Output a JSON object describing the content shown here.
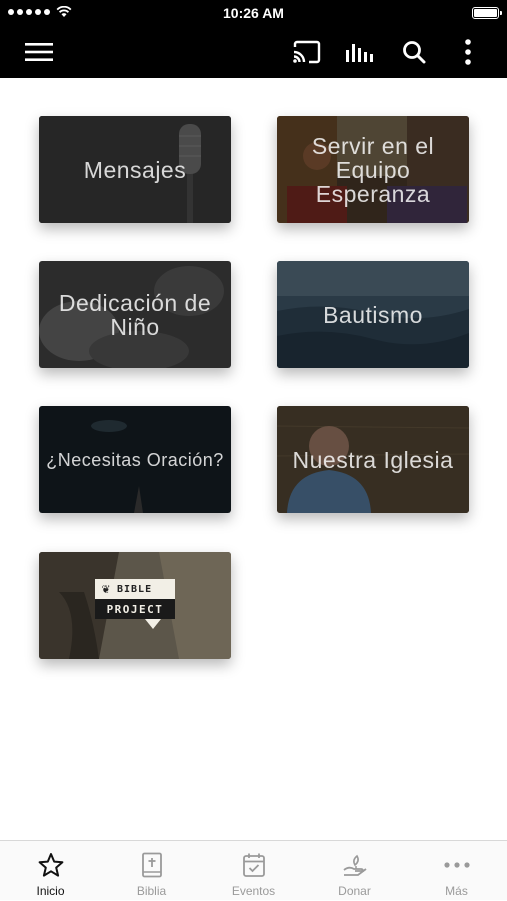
{
  "status_bar": {
    "time": "10:26 AM"
  },
  "toolbar": {
    "icons": [
      "menu-icon",
      "cast-icon",
      "audio-bars-icon",
      "search-icon",
      "more-vertical-icon"
    ]
  },
  "tiles": [
    {
      "label": "Mensajes"
    },
    {
      "label": "Servir en el Equipo Esperanza"
    },
    {
      "label": "Dedicación de Niño"
    },
    {
      "label": "Bautismo"
    },
    {
      "label": "¿Necesitas Oración?"
    },
    {
      "label": "Nuestra Iglesia"
    },
    {
      "label": "BIBLE PROJECT",
      "logo_top": "BIBLE",
      "logo_bottom": "PROJECT"
    }
  ],
  "tab_bar": {
    "tabs": [
      {
        "label": "Inicio",
        "icon": "star-icon",
        "active": true
      },
      {
        "label": "Biblia",
        "icon": "bible-icon",
        "active": false
      },
      {
        "label": "Eventos",
        "icon": "calendar-check-icon",
        "active": false
      },
      {
        "label": "Donar",
        "icon": "donate-icon",
        "active": false
      },
      {
        "label": "Más",
        "icon": "more-horizontal-icon",
        "active": false
      }
    ]
  },
  "colors": {
    "bar": "#000000",
    "tab_active": "#111111",
    "tab_inactive": "#9a9a9a"
  }
}
